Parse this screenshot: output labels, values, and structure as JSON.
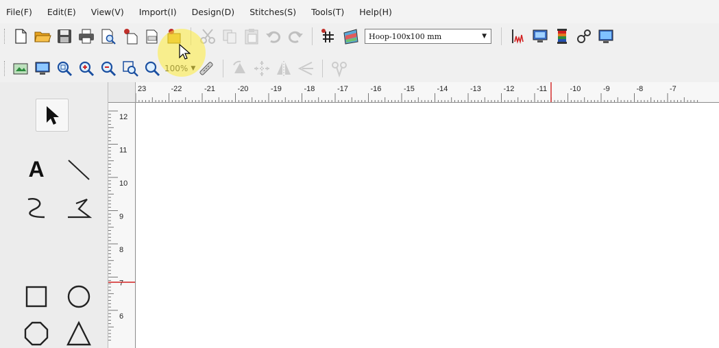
{
  "menu": [
    "File(F)",
    "Edit(E)",
    "View(V)",
    "Import(I)",
    "Design(D)",
    "Stitches(S)",
    "Tools(T)",
    "Help(H)"
  ],
  "toolbar1": {
    "icons": [
      "new-file-icon",
      "open-folder-icon",
      "save-icon",
      "print-icon",
      "print-preview-icon",
      "open-recent-icon",
      "export-icon",
      "import-bitmap-icon",
      "cut-icon",
      "copy-icon",
      "paste-icon",
      "undo-icon",
      "redo-icon",
      "grid-icon",
      "color-palette-icon",
      "stitch-chart-icon",
      "monitor-icon",
      "thread-color-icon",
      "settings-icon",
      "view-3d-icon"
    ],
    "hoop_value": "Hoop-100x100 mm"
  },
  "toolbar2": {
    "icons": [
      "image-view-icon",
      "monitor-zoom-icon",
      "zoom-fit-icon",
      "zoom-in-icon",
      "zoom-out-icon",
      "zoom-page-icon",
      "zoom-window-icon",
      "measure-icon",
      "rotate-icon",
      "move-icon",
      "mirror-icon",
      "align-icon",
      "embroider-icon"
    ],
    "zoom_value": "100%"
  },
  "tools": [
    "select-arrow-icon",
    "text-tool-icon",
    "line-tool-icon",
    "curve-tool-icon",
    "polyline-tool-icon",
    "rectangle-tool-icon",
    "circle-tool-icon",
    "octagon-tool-icon",
    "triangle-tool-icon"
  ],
  "ruler": {
    "horizontal": [
      "23",
      "-22",
      "-21",
      "-20",
      "-19",
      "-18",
      "-17",
      "-16",
      "-15",
      "-14",
      "-13",
      "-12",
      "-11",
      "-10",
      "-9",
      "-8",
      "-7"
    ],
    "vertical": [
      "12",
      "11",
      "10",
      "9",
      "8",
      "7",
      "6"
    ]
  },
  "colors": {
    "ruler_marker": "#d22020",
    "highlight": "#ffec3c"
  }
}
